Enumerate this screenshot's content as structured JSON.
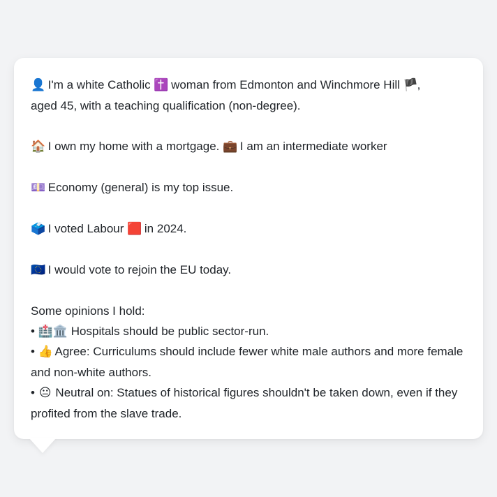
{
  "message": {
    "identity": {
      "icon": "👤",
      "text_a": "I'm a white Catholic",
      "icon2": "✝️",
      "text_b": "woman from Edmonton and Winchmore Hill",
      "icon3": "🏴",
      "text_c": ",",
      "text_d": "aged 45, with a teaching qualification (non-degree)."
    },
    "housing": {
      "icon": "🏠",
      "text": "I own my home with a mortgage.",
      "icon2": "💼",
      "text2": "I am an intermediate worker"
    },
    "issue": {
      "icon": "💷",
      "text": "Economy (general) is my top issue."
    },
    "vote": {
      "icon": "🗳️",
      "text_a": "I voted Labour",
      "icon2": "🟥",
      "text_b": "in 2024."
    },
    "eu": {
      "icon": "🇪🇺",
      "text": "I would vote to rejoin the EU today."
    },
    "opinions_heading": "Some opinions I hold:",
    "opinions": [
      {
        "bullet": "•",
        "icon": "🏥🏛️",
        "text": "Hospitals should be public sector-run."
      },
      {
        "bullet": "•",
        "icon": "👍",
        "text": "Agree: Curriculums should include fewer white male authors and more female and non-white authors."
      },
      {
        "bullet": "•",
        "icon": "😐",
        "text": "Neutral on: Statues of historical figures shouldn't be taken down, even if they profited from the slave trade."
      }
    ]
  }
}
